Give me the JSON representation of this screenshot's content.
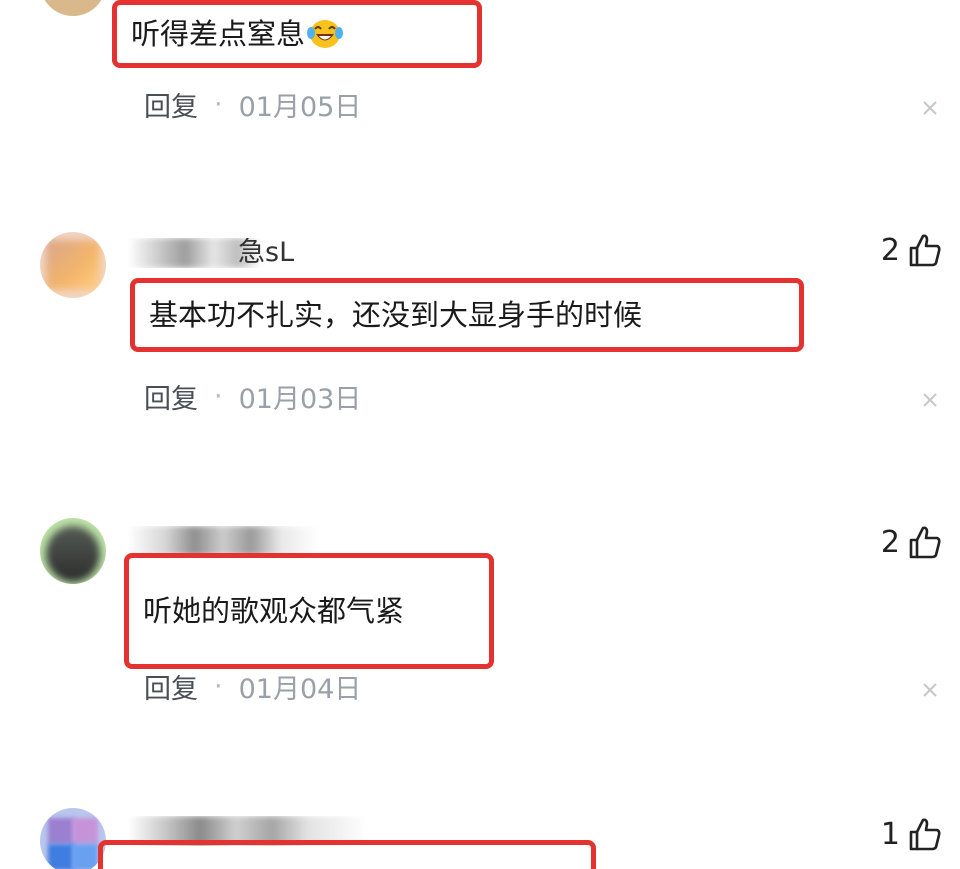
{
  "comments": [
    {
      "text": "听得差点窒息",
      "emoji_icon": "laughing-tears-emoji",
      "reply_label": "回复",
      "separator": "·",
      "date": "01月05日"
    },
    {
      "username_visible": "急sL",
      "likes": "2",
      "text": "基本功不扎实，还没到大显身手的时候",
      "reply_label": "回复",
      "separator": "·",
      "date": "01月03日"
    },
    {
      "likes": "2",
      "text": "听她的歌观众都气紧",
      "reply_label": "回复",
      "separator": "·",
      "date": "01月04日"
    },
    {
      "likes": "1"
    }
  ],
  "colors": {
    "highlight_border": "#e3322f",
    "meta_text": "#9aa0a8",
    "reply_text": "#4a4f57"
  }
}
